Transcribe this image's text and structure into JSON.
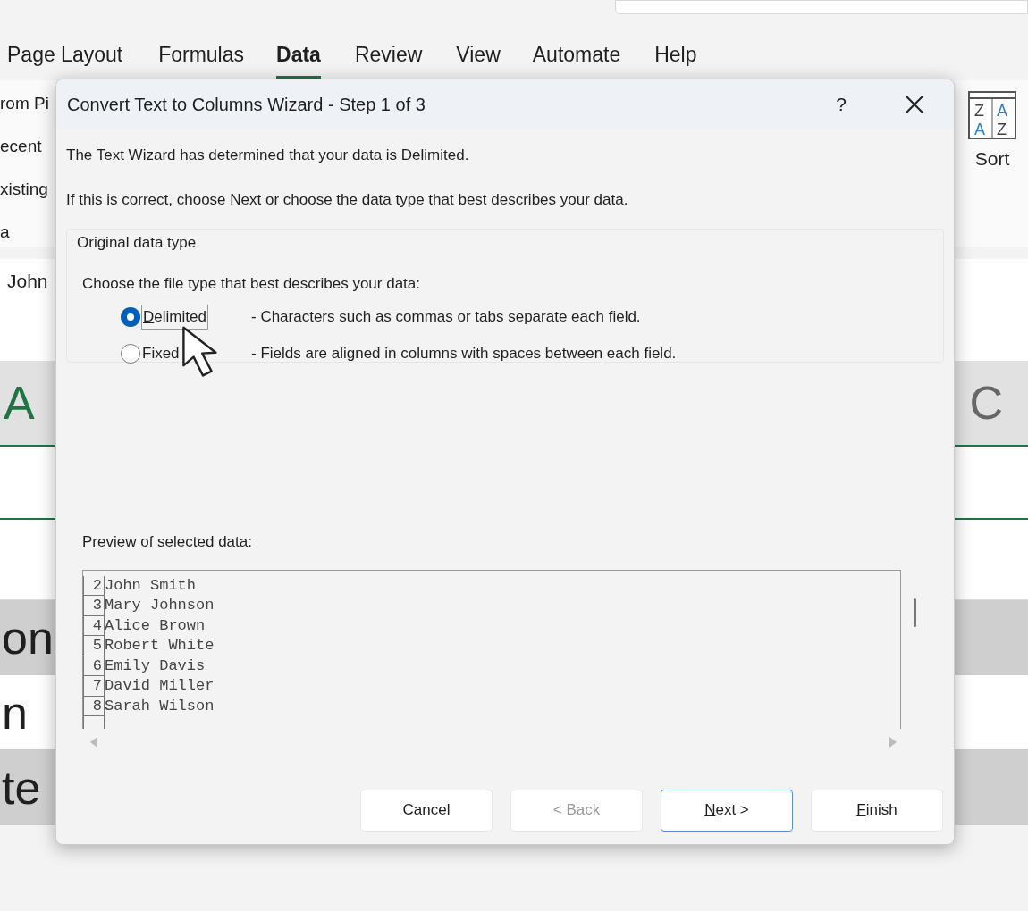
{
  "ribbon_tabs": [
    {
      "label": "Page Layout",
      "selected": false
    },
    {
      "label": "Formulas",
      "selected": false
    },
    {
      "label": "Data",
      "selected": true
    },
    {
      "label": "Review",
      "selected": false
    },
    {
      "label": "View",
      "selected": false
    },
    {
      "label": "Automate",
      "selected": false
    },
    {
      "label": "Help",
      "selected": false
    }
  ],
  "ribbon_left": [
    "rom Pi",
    "ecent",
    "xisting",
    "a"
  ],
  "sort_icon_letters": [
    "Z",
    "A",
    "A",
    "Z"
  ],
  "sort_label": "Sort",
  "formula_value": "John",
  "column_headers": [
    "A",
    "C"
  ],
  "cells": [
    "on",
    "n",
    "te"
  ],
  "dialog": {
    "title": "Convert Text to Columns Wizard - Step 1 of 3",
    "help": "?",
    "intro": "The Text Wizard has determined that your data is Delimited.",
    "hint": "If this is correct, choose Next or choose the data type that best describes your data.",
    "group_title": "Original data type",
    "prompt": "Choose the file type that best describes your data:",
    "options": [
      {
        "label": "Delimited",
        "description": "- Characters such as commas or tabs separate each field.",
        "selected": true,
        "underline_first": true
      },
      {
        "label": "Fixed",
        "description": "- Fields are aligned in columns with spaces between each field.",
        "selected": false,
        "underline_first": false
      }
    ],
    "preview_label": "Preview of selected data:",
    "preview_rows": [
      {
        "number": "2",
        "text": "John Smith"
      },
      {
        "number": "3",
        "text": "Mary Johnson"
      },
      {
        "number": "4",
        "text": "Alice Brown"
      },
      {
        "number": "5",
        "text": "Robert White"
      },
      {
        "number": "6",
        "text": "Emily Davis"
      },
      {
        "number": "7",
        "text": "David Miller"
      },
      {
        "number": "8",
        "text": "Sarah Wilson"
      }
    ],
    "buttons": [
      {
        "label": "Cancel",
        "disabled": false,
        "default": false,
        "underline_first": false
      },
      {
        "label": "< Back",
        "disabled": true,
        "default": false,
        "underline_first": false
      },
      {
        "label": "Next >",
        "disabled": false,
        "default": true,
        "underline_first": true
      },
      {
        "label": "Finish",
        "disabled": false,
        "default": false,
        "underline_first": true
      }
    ]
  }
}
